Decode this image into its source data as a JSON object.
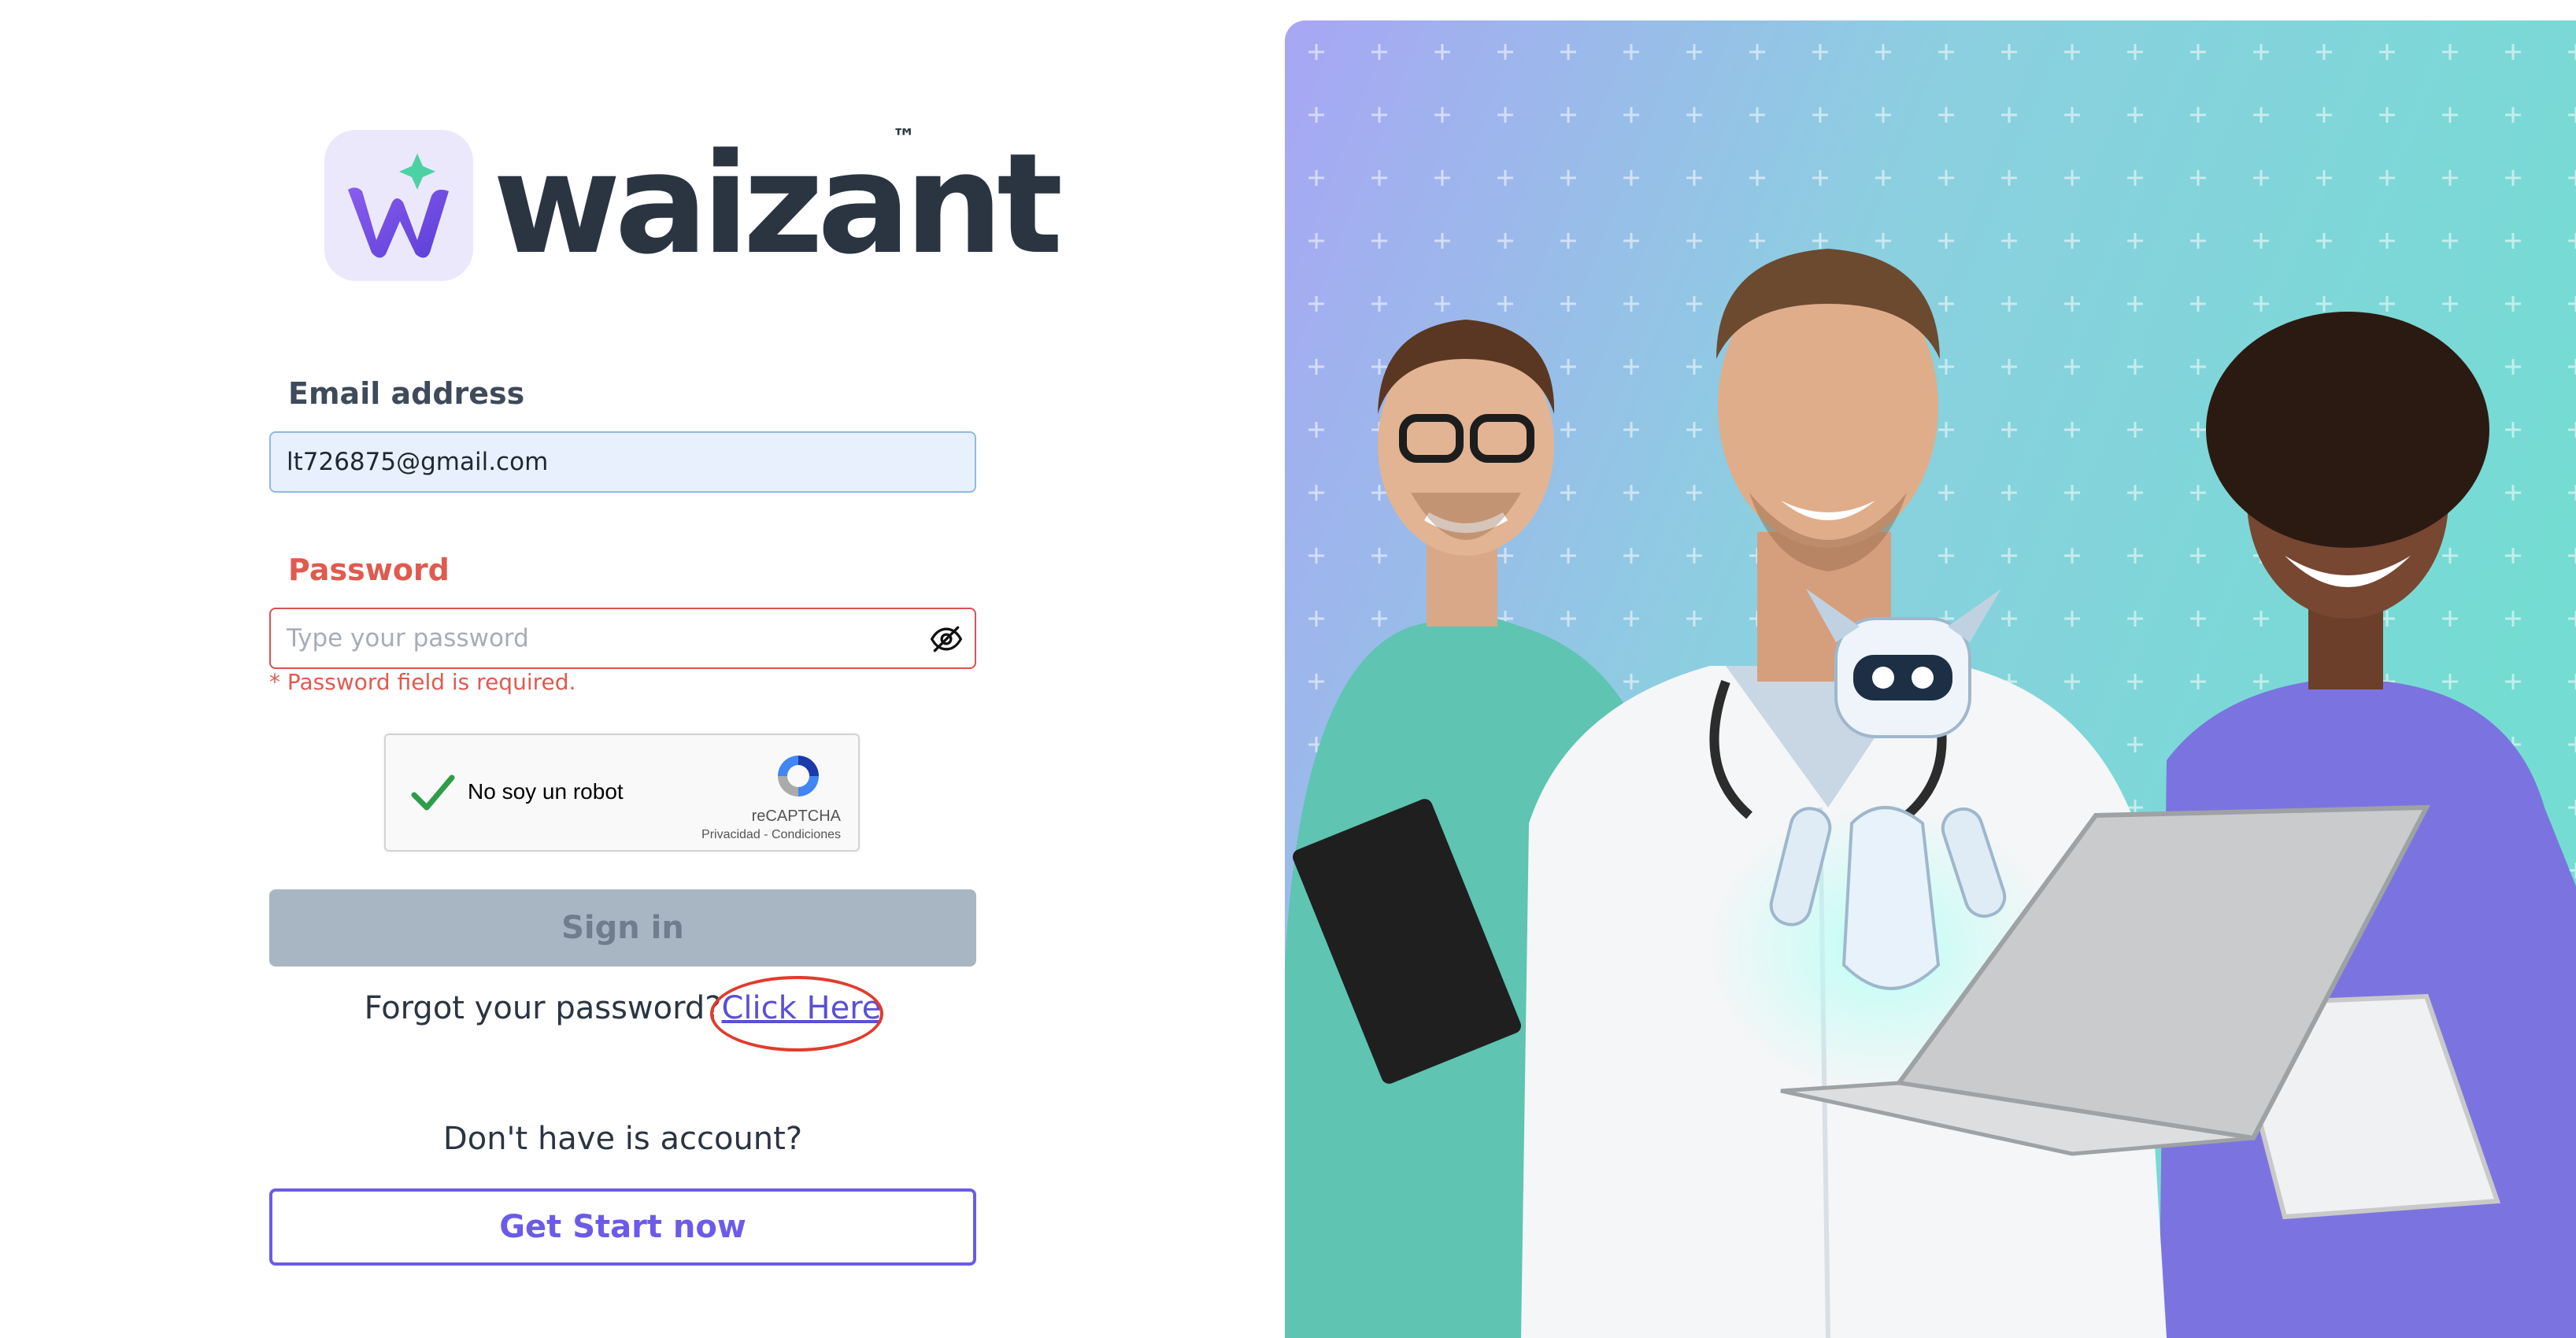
{
  "brand": {
    "name": "waizant",
    "trademark": "™",
    "logo_letter": "w"
  },
  "form": {
    "email_label": "Email address",
    "email_value": "lt726875@gmail.com",
    "password_label": "Password",
    "password_placeholder": "Type your password",
    "password_error": "* Password field is required."
  },
  "captcha": {
    "label": "No soy un robot",
    "brand": "reCAPTCHA",
    "links": "Privacidad - Condiciones",
    "checked": true
  },
  "actions": {
    "signin_label": "Sign in",
    "forgot_text": "Forgot your password?",
    "forgot_link": "Click Here",
    "no_account_text": "Don't have is account?",
    "get_start_label": "Get Start now"
  },
  "colors": {
    "accent": "#6b5be8",
    "error": "#e05a4f",
    "text": "#2b3542",
    "disabled_button": "#a8b6c4",
    "hero_gradient_start": "#a8a6f4",
    "hero_gradient_end": "#74dcd2"
  },
  "icons": {
    "password_toggle": "eye-off-icon",
    "captcha_check": "checkmark-icon",
    "captcha_logo": "recaptcha-logo-icon"
  }
}
